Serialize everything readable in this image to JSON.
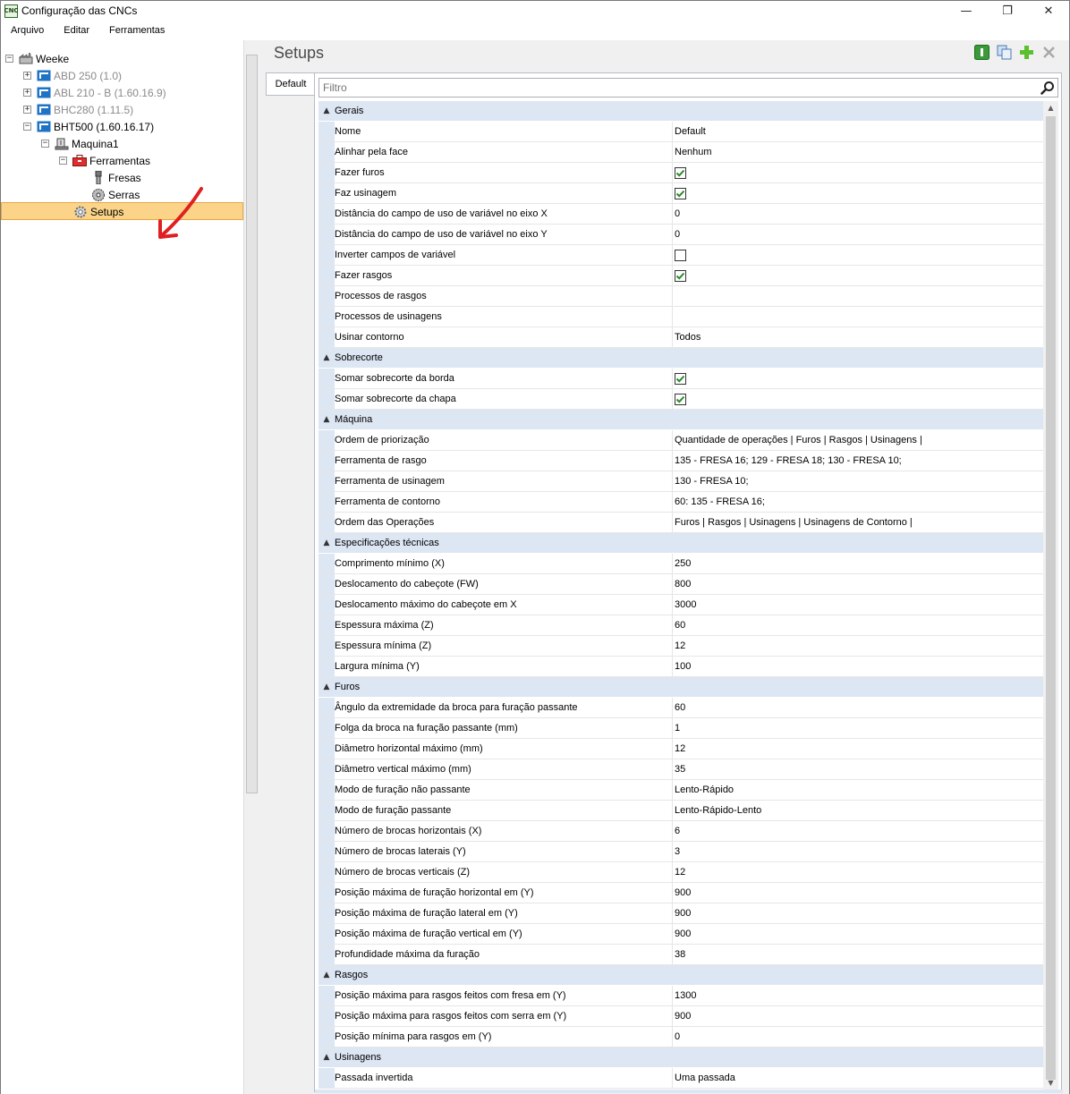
{
  "window": {
    "title": "Configuração das CNCs",
    "icon_text": "CNC",
    "minimize": "—",
    "restore": "❐",
    "close": "✕"
  },
  "menu": [
    "Arquivo",
    "Editar",
    "Ferramentas"
  ],
  "tree": {
    "root": "Weeke",
    "machines": [
      {
        "label": "ABD 250 (1.0)",
        "dim": true
      },
      {
        "label": "ABL 210 - B (1.60.16.9)",
        "dim": true
      },
      {
        "label": "BHC280 (1.11.5)",
        "dim": true
      },
      {
        "label": "BHT500 (1.60.16.17)",
        "dim": false
      }
    ],
    "maquina": "Maquina1",
    "ferramentas": "Ferramentas",
    "fresas": "Fresas",
    "serras": "Serras",
    "setups": "Setups",
    "expander_plus": "+",
    "expander_minus": "−"
  },
  "main": {
    "title": "Setups",
    "tab": "Default",
    "filter_placeholder": "Filtro"
  },
  "categories": [
    {
      "name": "Gerais",
      "rows": [
        {
          "name": "Nome",
          "value": "Default"
        },
        {
          "name": "Alinhar pela face",
          "value": "Nenhum"
        },
        {
          "name": "Fazer furos",
          "check": true
        },
        {
          "name": "Faz usinagem",
          "check": true
        },
        {
          "name": "Distância do campo de uso de variável no eixo X",
          "value": "0"
        },
        {
          "name": "Distância do campo de uso de variável no eixo Y",
          "value": "0"
        },
        {
          "name": "Inverter campos de variável",
          "check": false
        },
        {
          "name": "Fazer rasgos",
          "check": true
        },
        {
          "name": "Processos de rasgos",
          "value": ""
        },
        {
          "name": "Processos de usinagens",
          "value": ""
        },
        {
          "name": "Usinar contorno",
          "value": "Todos"
        }
      ]
    },
    {
      "name": "Sobrecorte",
      "rows": [
        {
          "name": "Somar sobrecorte da borda",
          "check": true
        },
        {
          "name": "Somar sobrecorte da chapa",
          "check": true
        }
      ]
    },
    {
      "name": "Máquina",
      "rows": [
        {
          "name": "Ordem de priorização",
          "value": "Quantidade de operações | Furos | Rasgos | Usinagens |"
        },
        {
          "name": "Ferramenta de rasgo",
          "value": "135 - FRESA 16; 129 - FRESA 18; 130 - FRESA 10;"
        },
        {
          "name": "Ferramenta de usinagem",
          "value": "130 - FRESA 10;"
        },
        {
          "name": "Ferramenta de contorno",
          "value": "60: 135 - FRESA 16;"
        },
        {
          "name": "Ordem das Operações",
          "value": "Furos | Rasgos | Usinagens | Usinagens de Contorno |"
        }
      ]
    },
    {
      "name": "Especificações técnicas",
      "rows": [
        {
          "name": "Comprimento mínimo (X)",
          "value": "250"
        },
        {
          "name": "Deslocamento do cabeçote (FW)",
          "value": "800"
        },
        {
          "name": "Deslocamento máximo do cabeçote em X",
          "value": "3000"
        },
        {
          "name": "Espessura máxima (Z)",
          "value": "60"
        },
        {
          "name": "Espessura mínima (Z)",
          "value": "12"
        },
        {
          "name": "Largura mínima (Y)",
          "value": "100"
        }
      ]
    },
    {
      "name": "Furos",
      "rows": [
        {
          "name": "Ângulo da extremidade da broca para furação passante",
          "value": "60"
        },
        {
          "name": "Folga da broca na furação passante (mm)",
          "value": "1"
        },
        {
          "name": "Diâmetro horizontal máximo (mm)",
          "value": "12"
        },
        {
          "name": "Diâmetro vertical máximo (mm)",
          "value": "35"
        },
        {
          "name": "Modo de furação não passante",
          "value": "Lento-Rápido"
        },
        {
          "name": "Modo de furação passante",
          "value": "Lento-Rápido-Lento"
        },
        {
          "name": "Número de brocas horizontais (X)",
          "value": "6"
        },
        {
          "name": "Número de brocas laterais (Y)",
          "value": "3"
        },
        {
          "name": "Número de brocas verticais (Z)",
          "value": "12"
        },
        {
          "name": "Posição máxima de furação horizontal em (Y)",
          "value": "900"
        },
        {
          "name": "Posição máxima de furação lateral em (Y)",
          "value": "900"
        },
        {
          "name": "Posição máxima de furação vertical em (Y)",
          "value": "900"
        },
        {
          "name": "Profundidade máxima da furação",
          "value": "38"
        }
      ]
    },
    {
      "name": "Rasgos",
      "rows": [
        {
          "name": "Posição máxima para rasgos feitos com fresa em (Y)",
          "value": "1300"
        },
        {
          "name": "Posição máxima para rasgos feitos com serra em (Y)",
          "value": "900"
        },
        {
          "name": "Posição mínima para rasgos em (Y)",
          "value": "0"
        }
      ]
    },
    {
      "name": "Usinagens",
      "rows": [
        {
          "name": "Passada invertida",
          "value": "Uma passada"
        }
      ]
    }
  ],
  "colors": {
    "selection": "#fbd489",
    "category_bg": "#dde6f3",
    "annotation_arrow": "#e02020",
    "check_green": "#2a8a2a"
  },
  "icons": {
    "info": "info-icon",
    "copy": "copy-icon",
    "add": "add-icon",
    "delete": "delete-icon",
    "search": "search-icon"
  }
}
